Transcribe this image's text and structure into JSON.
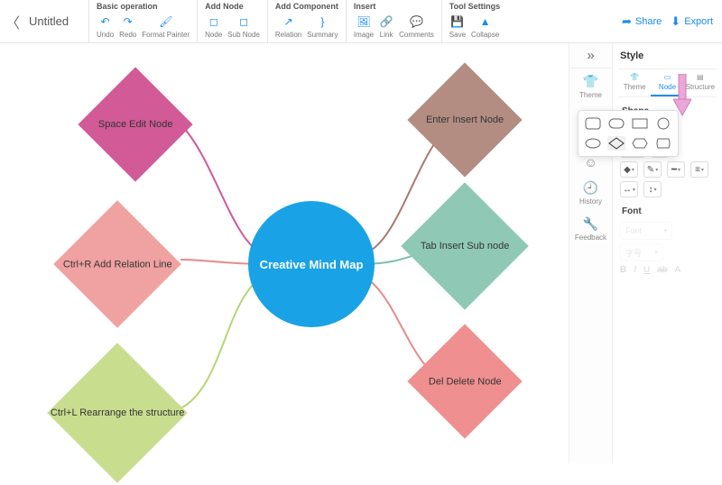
{
  "title": "Untitled",
  "groups": {
    "basic": {
      "label": "Basic operation",
      "undo": "Undo",
      "redo": "Redo",
      "format_painter": "Format Painter"
    },
    "add_node": {
      "label": "Add Node",
      "node": "Node",
      "sub_node": "Sub Node"
    },
    "add_component": {
      "label": "Add Component",
      "relation": "Relation",
      "summary": "Summary"
    },
    "insert": {
      "label": "Insert",
      "image": "Image",
      "link": "Link",
      "comments": "Comments"
    },
    "tool_settings": {
      "label": "Tool Settings",
      "save": "Save",
      "collapse": "Collapse"
    }
  },
  "top_actions": {
    "share": "Share",
    "export": "Export"
  },
  "mindmap": {
    "center": "Creative Mind Map",
    "nodes": {
      "n1": "Space Edit Node",
      "n2": "Ctrl+R Add Relation Line",
      "n3": "Ctrl+L Rearrange the structure",
      "n4": "Enter Insert Node",
      "n5": "Tab Insert Sub node",
      "n6": "Del Delete Node"
    }
  },
  "right_tabs": {
    "theme": "Theme",
    "style": "Style",
    "history": "History",
    "feedback": "Feedback"
  },
  "style_panel": {
    "title": "Style",
    "tabs": {
      "theme": "Theme",
      "node": "Node",
      "structure": "Structure"
    },
    "shape": "Shape",
    "font": "Font",
    "font_placeholder": "Font",
    "size_placeholder": "字号"
  }
}
